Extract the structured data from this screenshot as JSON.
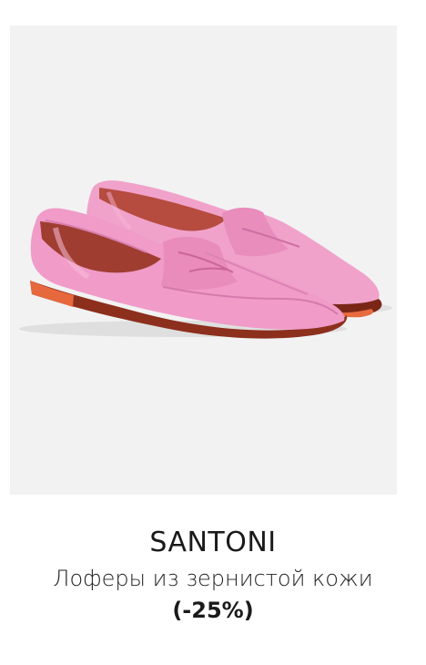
{
  "product": {
    "brand": "SANTONI",
    "title": "Лоферы из зернистой кожи",
    "discount": "(-25%)",
    "image_name": "product-image",
    "colors": {
      "shoe_pink": "#ef9ac6",
      "shoe_pink_dark": "#d86ea7",
      "sole_brown": "#8a2f1b",
      "sole_orange": "#e8693d",
      "lining": "#c6684e",
      "background": "#f2f2f2"
    }
  }
}
